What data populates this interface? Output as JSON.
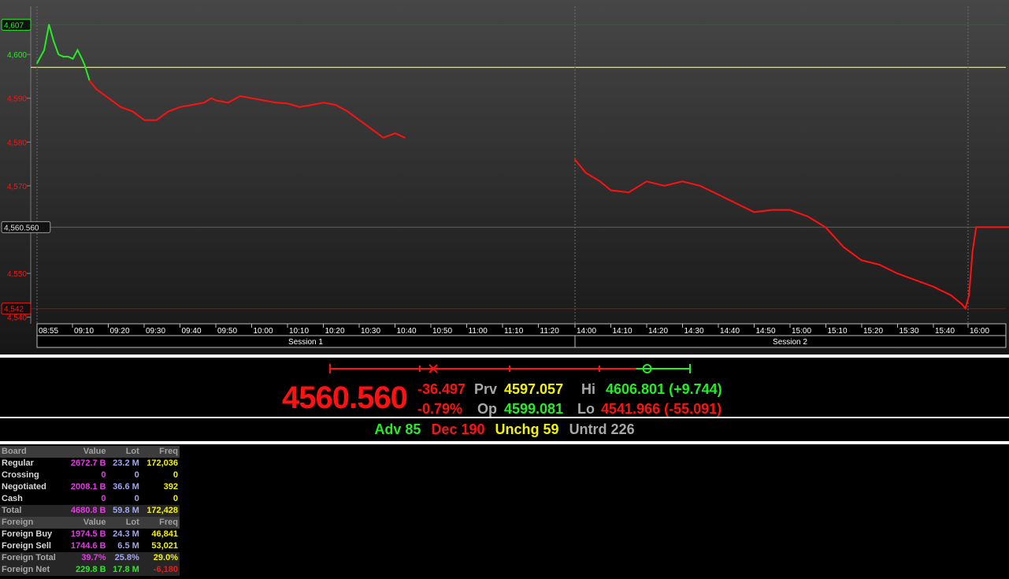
{
  "colors": {
    "up": "#22ee22",
    "down": "#ff1111",
    "flat": "#f2f20a",
    "neutral": "#a8a8a8",
    "value": "#e43be4",
    "lot": "#a4a4f0",
    "freq": "#f2f20a",
    "prev_line": "#f2f20a",
    "hi_line": "#1c6e1c",
    "lo_line": "#8a1515"
  },
  "chart_data": {
    "type": "line",
    "title": "",
    "xlabel": "",
    "ylabel": "",
    "y_axis_labels": [
      "4,600",
      "4,590",
      "4,580",
      "4,570",
      "4,550",
      "4,540"
    ],
    "y_ticks": [
      4600,
      4590,
      4580,
      4570,
      4550,
      4540
    ],
    "ylim": [
      4538.5,
      4611
    ],
    "markers": {
      "high": {
        "label": "4,607",
        "value": 4606.801
      },
      "last": {
        "label": "4,560.560",
        "value": 4560.56
      },
      "low": {
        "label": "4,542",
        "value": 4541.966
      },
      "previous": {
        "value": 4597.057
      }
    },
    "sessions": [
      {
        "name": "Session 1",
        "x_tick_labels": [
          "08:55",
          "09:10",
          "09:20",
          "09:30",
          "09:40",
          "09:50",
          "10:00",
          "10:10",
          "10:20",
          "10:30",
          "10:40",
          "10:50",
          "11:00",
          "11:10",
          "11:20"
        ],
        "x": [
          "08:55",
          "08:58",
          "09:00",
          "09:02",
          "09:04",
          "09:06",
          "09:08",
          "09:10",
          "09:12",
          "09:14",
          "09:15",
          "09:17",
          "09:20",
          "09:25",
          "09:30",
          "09:35",
          "09:40",
          "09:45",
          "09:50",
          "09:55",
          "10:00",
          "10:05",
          "10:08",
          "10:10",
          "10:15",
          "10:20",
          "10:25",
          "10:30",
          "10:35",
          "10:40",
          "10:45",
          "10:50",
          "10:55",
          "11:00",
          "11:05",
          "11:10",
          "11:15",
          "11:20",
          "11:25",
          "11:29"
        ],
        "y": [
          4598,
          4601,
          4606.8,
          4603,
          4600,
          4599.5,
          4599.5,
          4599,
          4601,
          4598.8,
          4597.5,
          4594,
          4592,
          4590,
          4588,
          4587,
          4585,
          4585,
          4587,
          4588,
          4588.5,
          4589,
          4590,
          4589.5,
          4589,
          4590.5,
          4590,
          4589.5,
          4589,
          4588.8,
          4588,
          4588.5,
          4589,
          4588.5,
          4587,
          4585,
          4583,
          4581,
          4582,
          4581
        ]
      },
      {
        "name": "Session 2",
        "x_tick_labels": [
          "14:00",
          "14:10",
          "14:20",
          "14:30",
          "14:40",
          "14:50",
          "15:00",
          "15:10",
          "15:20",
          "15:30",
          "15:40",
          "16:00"
        ],
        "x": [
          "14:00",
          "14:03",
          "14:07",
          "14:10",
          "14:15",
          "14:20",
          "14:25",
          "14:30",
          "14:35",
          "14:40",
          "14:45",
          "14:50",
          "14:55",
          "15:00",
          "15:05",
          "15:10",
          "15:15",
          "15:20",
          "15:25",
          "15:30",
          "15:35",
          "15:40",
          "15:45",
          "15:48",
          "15:49",
          "15:50",
          "15:51",
          "15:52",
          "16:00",
          "16:10"
        ],
        "y": [
          4576,
          4573,
          4571,
          4569,
          4568.5,
          4571,
          4570,
          4571,
          4570,
          4568,
          4566,
          4564,
          4564.5,
          4564.5,
          4563,
          4560.5,
          4556,
          4553,
          4552,
          4550,
          4548.5,
          4547,
          4545,
          4543,
          4542,
          4545,
          4555,
          4560.56,
          4560.56,
          4560.56
        ]
      }
    ]
  },
  "summary": {
    "last": "4560.560",
    "change": "-36.497",
    "change_pct": "-0.79%",
    "prev_label": "Prv",
    "prev_value": "4597.057",
    "open_label": "Op",
    "open_value": "4599.081",
    "hi_label": "Hi",
    "hi_value": "4606.801 (+9.744)",
    "lo_label": "Lo",
    "lo_value": "4541.966 (-55.091)",
    "range": {
      "low": 4541.966,
      "high": 4606.801,
      "prev": 4597.057,
      "open": 4599.081,
      "last": 4560.56
    }
  },
  "breadth": {
    "adv": "Adv 85",
    "dec": "Dec 190",
    "unchg": "Unchg 59",
    "untrd": "Untrd 226"
  },
  "board": {
    "header": [
      "Board",
      "Value",
      "Lot",
      "Freq"
    ],
    "rows": [
      {
        "label": "Regular",
        "value": "2672.7 B",
        "lot": "23.2 M",
        "freq": "172,036"
      },
      {
        "label": "Crossing",
        "value": "0",
        "lot": "0",
        "freq": "0"
      },
      {
        "label": "Negotiated",
        "value": "2008.1 B",
        "lot": "36.6 M",
        "freq": "392"
      },
      {
        "label": "Cash",
        "value": "0",
        "lot": "0",
        "freq": "0"
      }
    ],
    "total": {
      "label": "Total",
      "value": "4680.8 B",
      "lot": "59.8 M",
      "freq": "172,428"
    }
  },
  "foreign": {
    "header": [
      "Foreign",
      "Value",
      "Lot",
      "Freq"
    ],
    "rows": [
      {
        "label": "Foreign Buy",
        "value": "1974.5 B",
        "lot": "24.3 M",
        "freq": "46,841"
      },
      {
        "label": "Foreign Sell",
        "value": "1744.6 B",
        "lot": "6.5 M",
        "freq": "53,021"
      }
    ],
    "total": {
      "label": "Foreign Total",
      "value": "39.7%",
      "lot": "25.8%",
      "freq": "29.0%"
    },
    "net": {
      "label": "Foreign Net",
      "value": "229.8 B",
      "lot": "17.8 M",
      "freq": "-6,180"
    }
  }
}
